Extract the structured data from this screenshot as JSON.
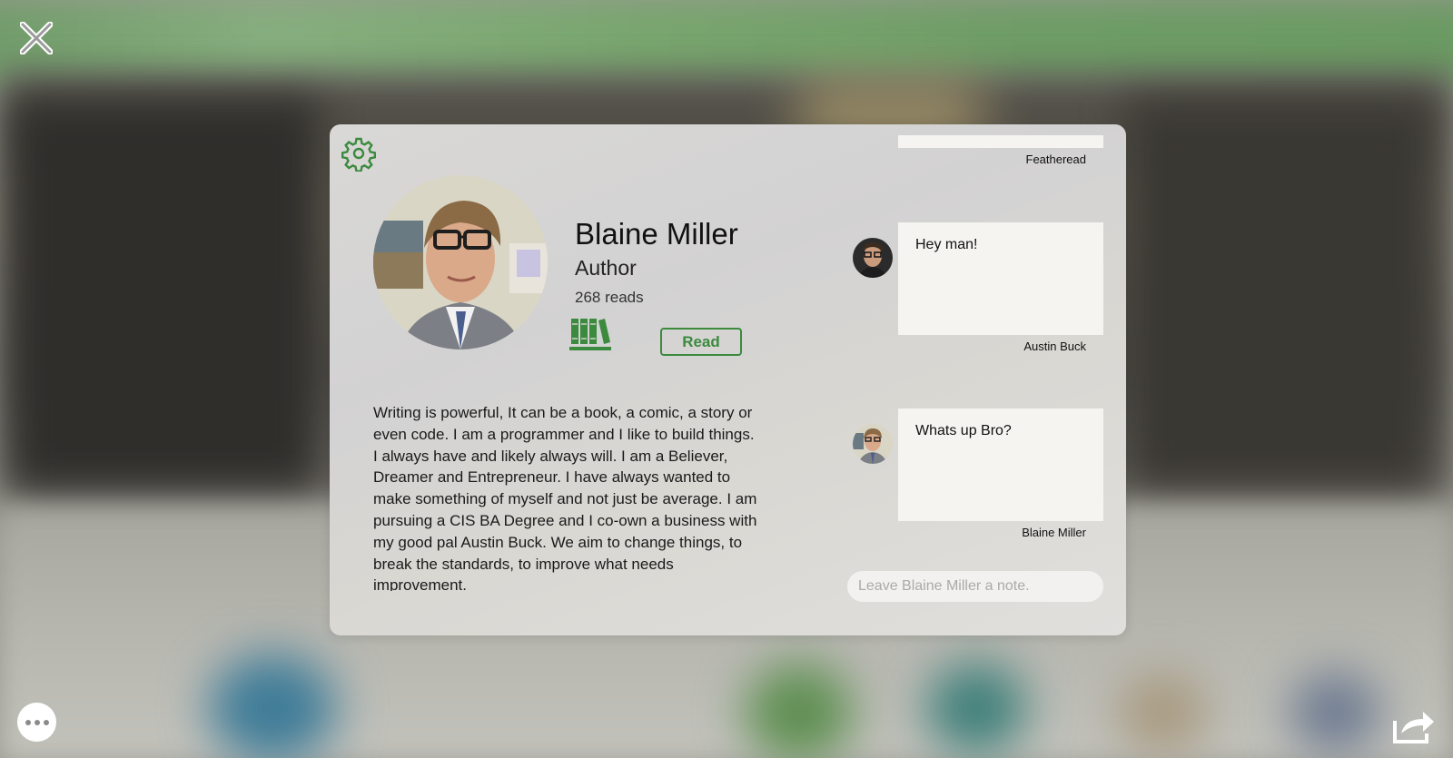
{
  "profile": {
    "name": "Blaine Miller",
    "role": "Author",
    "reads": "268 reads",
    "read_button": "Read",
    "bio": "Writing is powerful, It can be a book, a comic, a story or even code. I am a programmer and I like to build things. I always have and likely always will. I am a Believer, Dreamer and Entrepreneur. I have always wanted to make something of myself and not just be average. I am pursuing a CIS BA Degree and I co-own a business with my good pal Austin Buck. We aim to change things, to break the standards, to improve what needs improvement."
  },
  "notes": [
    {
      "text": "",
      "author": "Featheread"
    },
    {
      "text": "Hey man!",
      "author": "Austin Buck"
    },
    {
      "text": "Whats up Bro?",
      "author": "Blaine Miller"
    }
  ],
  "note_input": {
    "placeholder": "Leave Blaine Miller a note.",
    "value": ""
  },
  "icons": {
    "close": "close-x-icon",
    "settings": "gear-icon",
    "library": "books-icon",
    "more": "ellipsis-icon",
    "share": "share-icon"
  },
  "colors": {
    "accent": "#3b8a3e",
    "note_bg": "#f6f4f1"
  }
}
